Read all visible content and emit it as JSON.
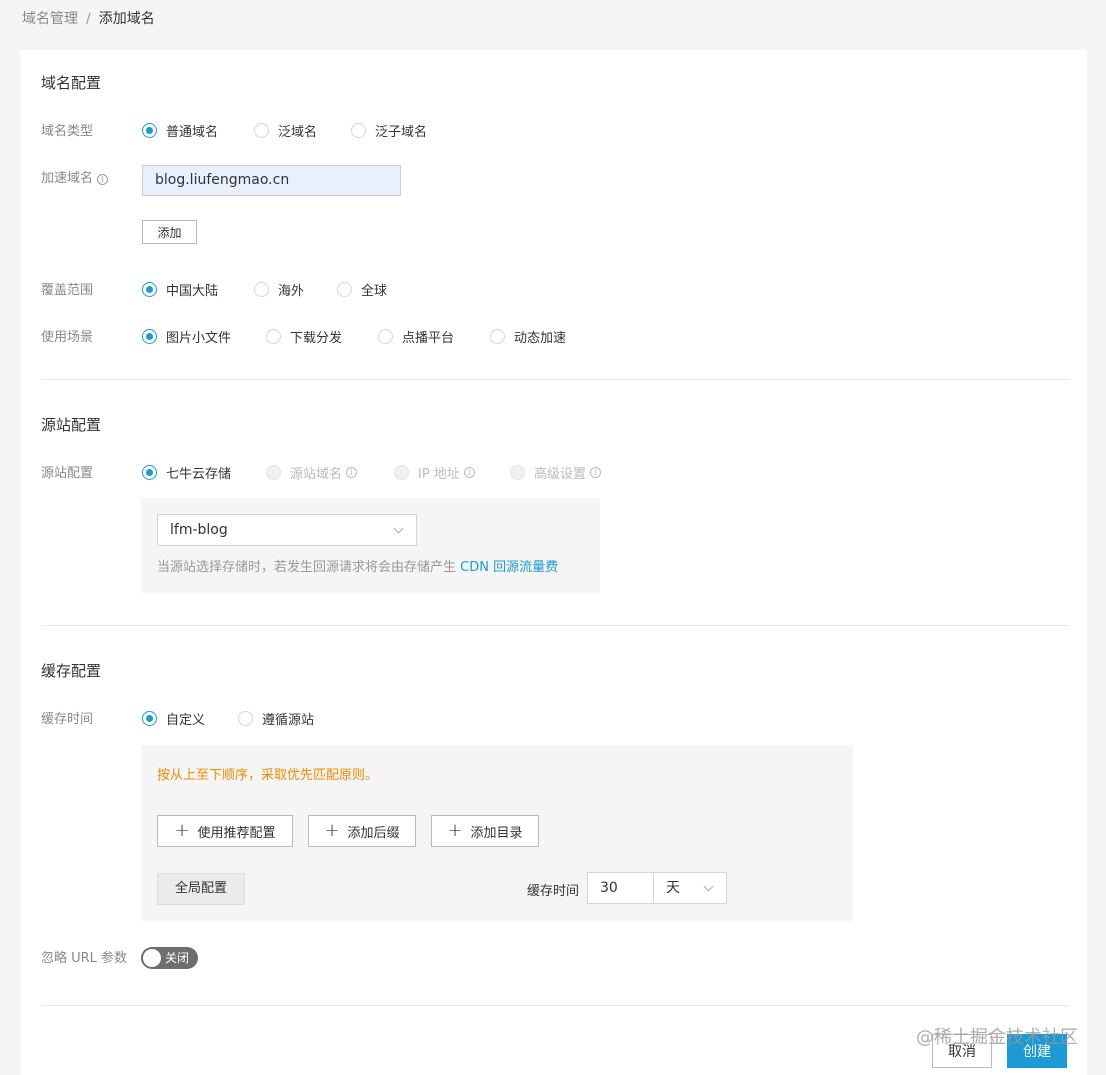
{
  "breadcrumb": {
    "parent": "域名管理",
    "separator": "/",
    "current": "添加域名"
  },
  "domain_config": {
    "title": "域名配置",
    "type": {
      "label": "域名类型",
      "options": [
        "普通域名",
        "泛域名",
        "泛子域名"
      ],
      "selected": "普通域名"
    },
    "accel": {
      "label": "加速域名",
      "value": "blog.liufengmao.cn",
      "add_button": "添加"
    },
    "coverage": {
      "label": "覆盖范围",
      "options": [
        "中国大陆",
        "海外",
        "全球"
      ],
      "selected": "中国大陆"
    },
    "scene": {
      "label": "使用场景",
      "options": [
        "图片小文件",
        "下载分发",
        "点播平台",
        "动态加速"
      ],
      "selected": "图片小文件"
    }
  },
  "origin_config": {
    "title": "源站配置",
    "row_label": "源站配置",
    "options": [
      "七牛云存储",
      "源站域名",
      "IP 地址",
      "高级设置"
    ],
    "selected": "七牛云存储",
    "bucket": "lfm-blog",
    "hint_prefix": "当源站选择存储时，若发生回源请求将会由存储产生",
    "hint_link": "CDN 回源流量费"
  },
  "cache_config": {
    "title": "缓存配置",
    "time_label": "缓存时间",
    "options": [
      "自定义",
      "遵循源站"
    ],
    "selected": "自定义",
    "notice": "按从上至下顺序，采取优先匹配原则。",
    "buttons": {
      "recommend": "使用推荐配置",
      "suffix": "添加后缀",
      "directory": "添加目录"
    },
    "global_label": "全局配置",
    "cache_time_label": "缓存时间",
    "cache_time_value": "30",
    "cache_time_unit": "天"
  },
  "ignore_url": {
    "label": "忽略 URL 参数",
    "toggle_text": "关闭",
    "enabled": false
  },
  "footer": {
    "cancel": "取消",
    "create": "创建"
  },
  "watermark": "@稀土掘金技术社区",
  "colors": {
    "accent": "#1b9ad6",
    "warning": "#f08c00",
    "toggle_off": "#6e6e6e"
  }
}
